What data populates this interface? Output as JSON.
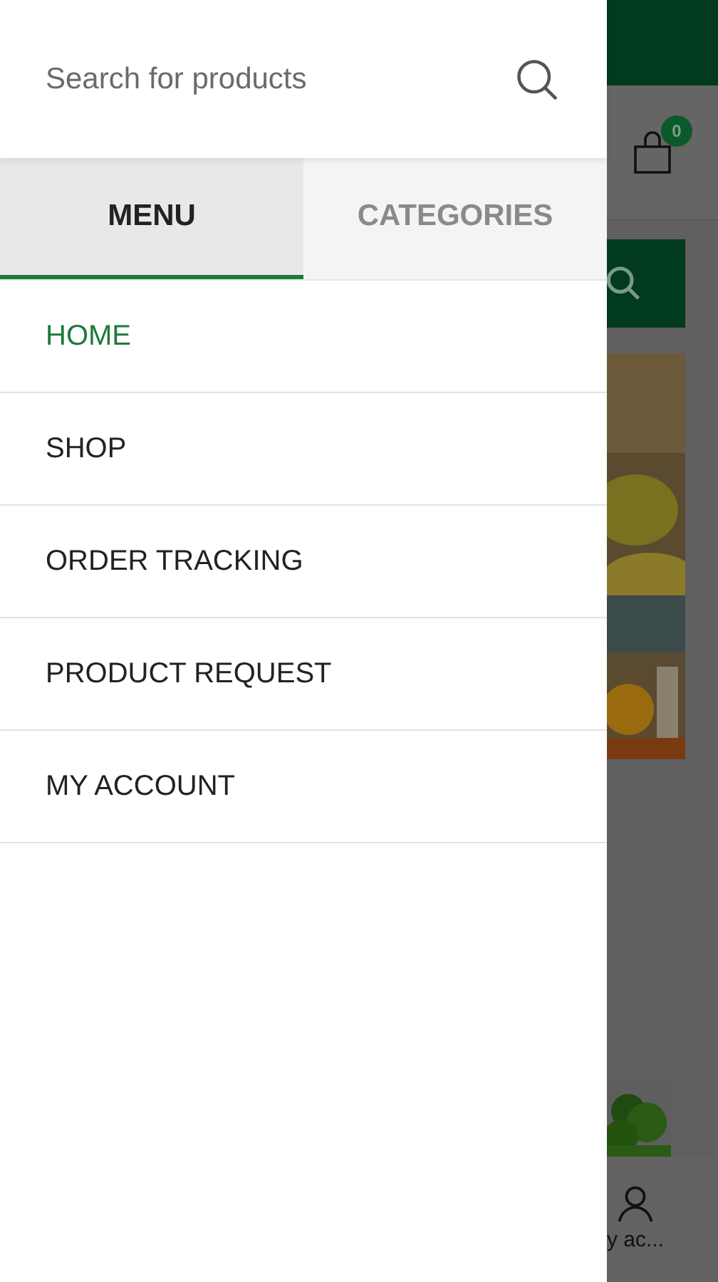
{
  "drawer": {
    "search": {
      "placeholder": "Search for products"
    },
    "tabs": [
      {
        "label": "MENU",
        "selected": true
      },
      {
        "label": "CATEGORIES",
        "selected": false
      }
    ],
    "menu_items": [
      {
        "label": "HOME",
        "selected": true
      },
      {
        "label": "SHOP",
        "selected": false
      },
      {
        "label": "ORDER TRACKING",
        "selected": false
      },
      {
        "label": "PRODUCT REQUEST",
        "selected": false
      },
      {
        "label": "MY ACCOUNT",
        "selected": false
      }
    ]
  },
  "background_page": {
    "cart_count": "0",
    "bottom_nav": [
      {
        "label": "y ac..."
      }
    ]
  }
}
